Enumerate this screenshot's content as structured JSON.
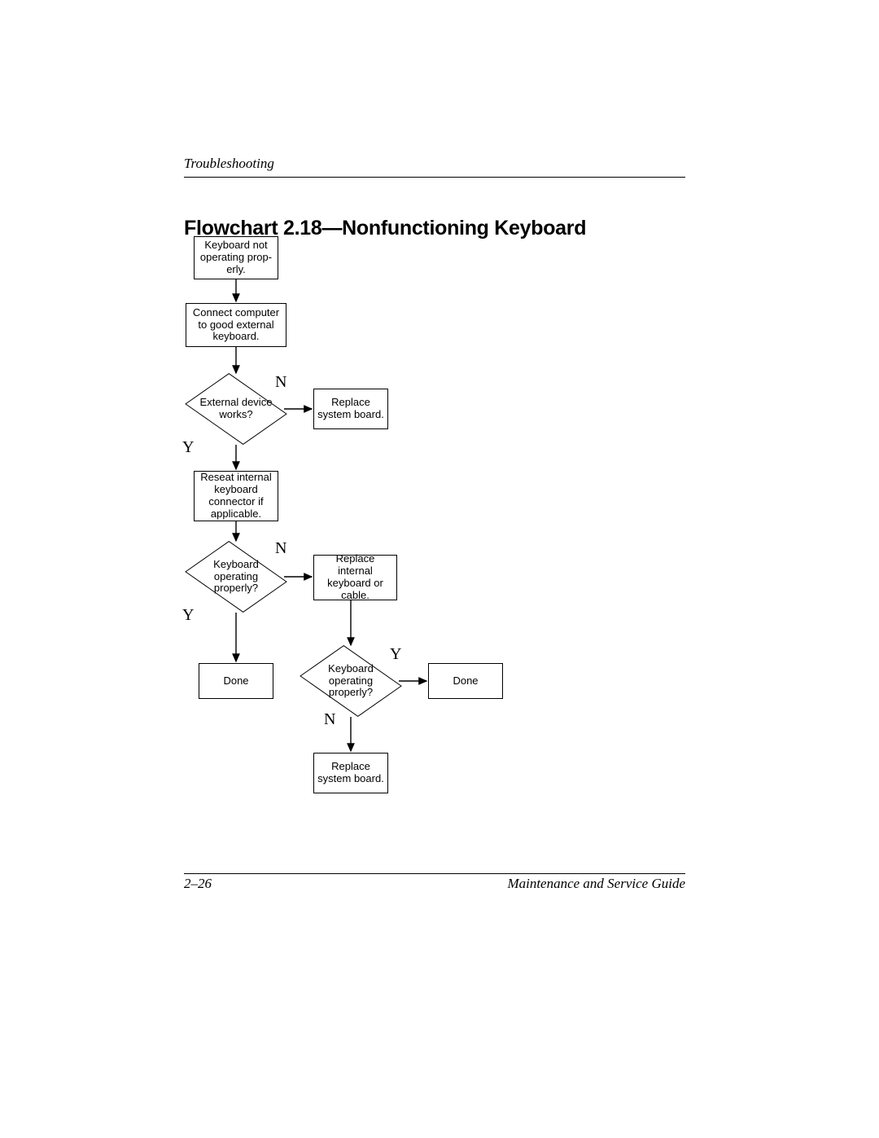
{
  "header": {
    "section": "Troubleshooting"
  },
  "title": "Flowchart 2.18—Nonfunctioning Keyboard",
  "footer": {
    "page": "2–26",
    "doc": "Maintenance and Service Guide"
  },
  "labels": {
    "yes": "Y",
    "no": "N"
  },
  "nodes": {
    "start": "Keyboard not operating prop­erly.",
    "connect": "Connect computer to good external key­board.",
    "extWorks": "External device works?",
    "replaceSB1": "Replace system board.",
    "reseat": "Reseat internal key­board connector if applicable.",
    "kbOp1": "Keyboard operating properly?",
    "replaceKB": "Replace internal keyboard or cable.",
    "done1": "Done",
    "kbOp2": "Keyboard operating properly?",
    "done2": "Done",
    "replaceSB2": "Replace system board."
  }
}
